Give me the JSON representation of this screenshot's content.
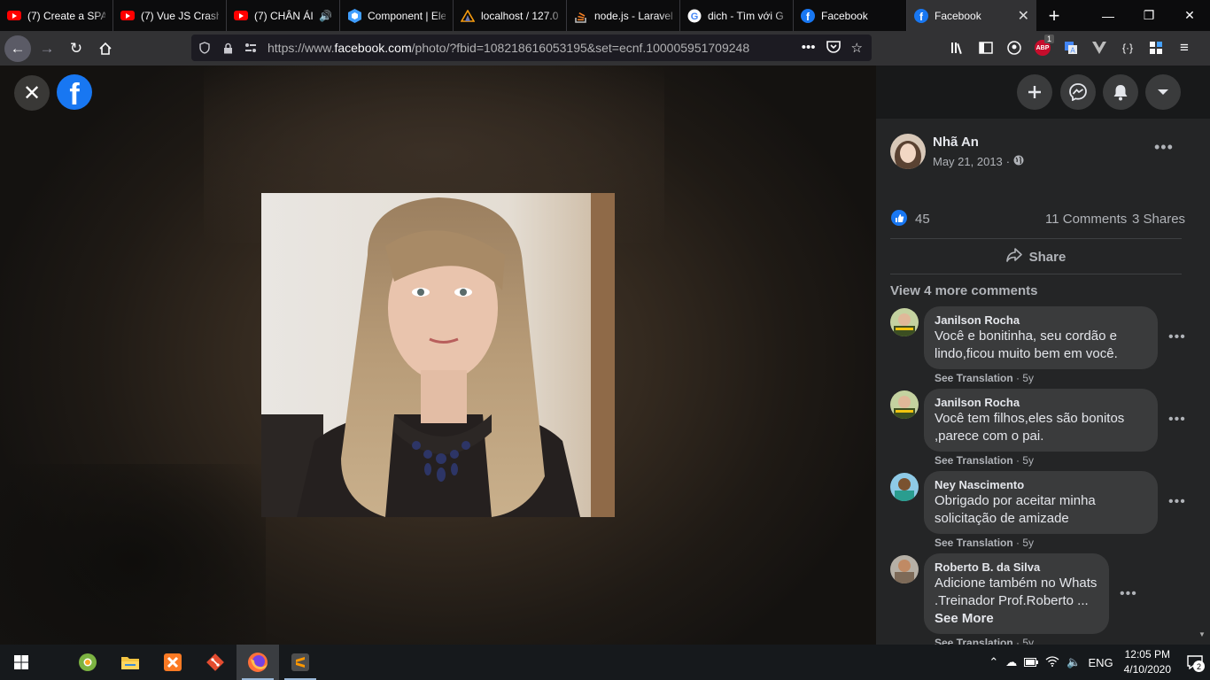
{
  "browser": {
    "tabs": [
      {
        "title": "(7) Create a SPA",
        "icon": "youtube-icon"
      },
      {
        "title": "(7) Vue JS Crash",
        "icon": "youtube-icon"
      },
      {
        "title": "(7) CHÂN ÁI",
        "icon": "youtube-icon"
      },
      {
        "title": "Component | Ele",
        "icon": "element-ui-icon"
      },
      {
        "title": "localhost / 127.0",
        "icon": "phpmyadmin-icon"
      },
      {
        "title": "node.js - Laravel",
        "icon": "stackoverflow-icon"
      },
      {
        "title": "dich - Tìm với G",
        "icon": "google-icon"
      },
      {
        "title": "Facebook",
        "icon": "facebook-icon"
      },
      {
        "title": "Facebook",
        "icon": "facebook-icon"
      }
    ],
    "url_prefix": "https://www.",
    "url_domain": "facebook.com",
    "url_rest": "/photo/?fbid=108218616053195&set=ecnf.100005951709248",
    "abp_badge": "1"
  },
  "post": {
    "author": "Nhã An",
    "date": "May 21, 2013",
    "privacy_icon": "globe-icon",
    "likes": "45",
    "comments": "11 Comments",
    "shares": "3 Shares",
    "share_label": "Share",
    "view_more": "View 4 more comments"
  },
  "comments": [
    {
      "name": "Janilson Rocha",
      "text": "Você e bonitinha, seu cordão e lindo,ficou muito bem em você.",
      "translate": "See Translation",
      "age": "5y"
    },
    {
      "name": "Janilson Rocha",
      "text": "Você tem filhos,eles são bonitos ,parece com o pai.",
      "translate": "See Translation",
      "age": "5y"
    },
    {
      "name": "Ney Nascimento",
      "text": "Obrigado por aceitar minha solicitação de amizade",
      "translate": "See Translation",
      "age": "5y"
    },
    {
      "name": "Roberto B. da Silva",
      "text": "Adicione também no Whats .Treinador Prof.Roberto ...",
      "see_more": "See More",
      "translate": "See Translation",
      "age": "5y"
    }
  ],
  "taskbar": {
    "apps": [
      "chrome-canary-icon",
      "file-explorer-icon",
      "xampp-icon",
      "git-icon",
      "firefox-icon",
      "sublime-text-icon"
    ],
    "language": "ENG",
    "time": "12:05 PM",
    "date": "4/10/2020",
    "notifications": "2"
  },
  "colors": {
    "facebook_blue": "#1877f2",
    "panel_bg": "#242526",
    "bubble_bg": "#3a3b3c"
  }
}
